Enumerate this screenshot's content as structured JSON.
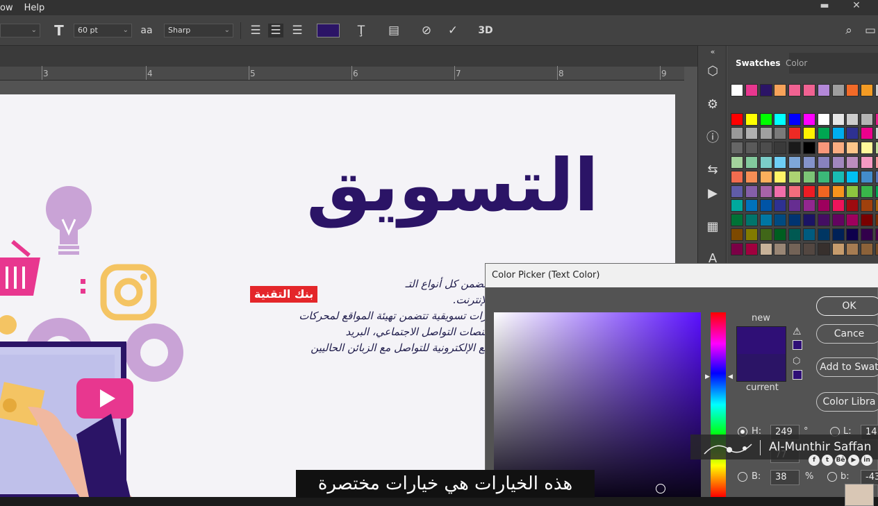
{
  "menu": {
    "items": [
      "ow",
      "Help"
    ]
  },
  "window_controls": {
    "minimize": "▬",
    "close": "✕"
  },
  "options_bar": {
    "font_size": "60 pt",
    "antialias_label": "a͏a",
    "antialias": "Sharp",
    "text_color": "#2b1466"
  },
  "ruler": {
    "labels": [
      "3",
      "4",
      "5",
      "6",
      "7",
      "8",
      "9"
    ]
  },
  "artboard": {
    "headline": "التسويق",
    "body_lines": [
      "يتضمن كل أنواع التـ",
      "الإنترنت.",
      "ارات تسويقية تتضمن تهيئة المواقع لمحركات",
      "منصات التواصل الاجتماعي، البريد",
      "مع الإلكترونية للتواصل مع الزبائن الحاليين"
    ],
    "brand_badge": "بنك التقنية"
  },
  "panel": {
    "tabs": [
      "Swatches",
      "Color"
    ],
    "swatches": [
      [
        "#ffffff",
        "#e8378f",
        "#2b1466",
        "#f7a35a",
        "#f06292",
        "#f06292",
        "#b388d8",
        "#9e9e9e",
        "#f26a28",
        "#f39b24",
        "#cfcfcf"
      ],
      [],
      [
        "#ff0000",
        "#ffff00",
        "#00ff00",
        "#00ffff",
        "#0000ff",
        "#ff00ff",
        "#ffffff",
        "#e6e6e6",
        "#cccccc",
        "#b3b3b3",
        "#e91e8c"
      ],
      [
        "#999999",
        "#b0b0b0",
        "#a0a0a0",
        "#7a7a7a",
        "#ed2a24",
        "#fff200",
        "#00a651",
        "#00aeef",
        "#2e3192",
        "#ec008c",
        "#d4d4d4"
      ],
      [
        "#666666",
        "#5a5a5a",
        "#4d4d4d",
        "#3a3a3a",
        "#1a1a1a",
        "#000000",
        "#f7977a",
        "#f9ad81",
        "#fdc68a",
        "#fff79a",
        "#c4df9b"
      ],
      [
        "#a3d39c",
        "#82ca9d",
        "#7bcdc8",
        "#6ecff6",
        "#7ea7d8",
        "#8493ca",
        "#8882be",
        "#a187be",
        "#bc8dbf",
        "#f49ac2",
        "#f6989d"
      ],
      [
        "#f26c4f",
        "#f68e55",
        "#fbaf5c",
        "#fff467",
        "#acd372",
        "#7cc576",
        "#3bb878",
        "#1abbb4",
        "#00bff3",
        "#438cca",
        "#5574b9"
      ],
      [
        "#605ca8",
        "#855fa8",
        "#a763a8",
        "#f06eaa",
        "#f26d7d",
        "#ed1c24",
        "#f26522",
        "#f7941d",
        "#8dc63f",
        "#39b54a",
        "#00a651"
      ],
      [
        "#00a99d",
        "#0072bc",
        "#0054a6",
        "#2e3192",
        "#662d91",
        "#92278f",
        "#9e005d",
        "#ed145b",
        "#9e0b0f",
        "#a0410d",
        "#a36209"
      ],
      [
        "#007236",
        "#00746b",
        "#0076a3",
        "#004a80",
        "#003471",
        "#1b1464",
        "#440e62",
        "#630460",
        "#9e005d",
        "#790000",
        "#7b2e00"
      ],
      [
        "#7d4900",
        "#827b00",
        "#406618",
        "#005e20",
        "#005952",
        "#005b7f",
        "#003663",
        "#002157",
        "#0d004c",
        "#32004b",
        "#4b0049"
      ],
      [
        "#7b0046",
        "#a0003e",
        "#c7b299",
        "#998675",
        "#736357",
        "#534741",
        "#37302d",
        "#c69c6d",
        "#a67c52",
        "#8c6239",
        "#754c24"
      ]
    ]
  },
  "dialog": {
    "title": "Color Picker (Text Color)",
    "new_label": "new",
    "current_label": "current",
    "ok": "OK",
    "cancel": "Cance",
    "add_to_swatches": "Add to Swat",
    "color_libraries": "Color Libra",
    "h_label": "H:",
    "h_value": "249",
    "h_unit": "°",
    "s_value": "77",
    "b_label": "B:",
    "b_value": "38",
    "b_unit": "%",
    "l_label": "L:",
    "l_value": "14",
    "b2_label": "b:",
    "b2_value": "-43",
    "new_color": "#2f0f76",
    "current_color": "#2b1466"
  },
  "watermark": {
    "name": "Al-Munthir Saffan",
    "socials": [
      "f",
      "t",
      "Bē",
      "▶",
      "in"
    ]
  },
  "subtitle": "هذه الخيارات هي خيارات مختصرة"
}
